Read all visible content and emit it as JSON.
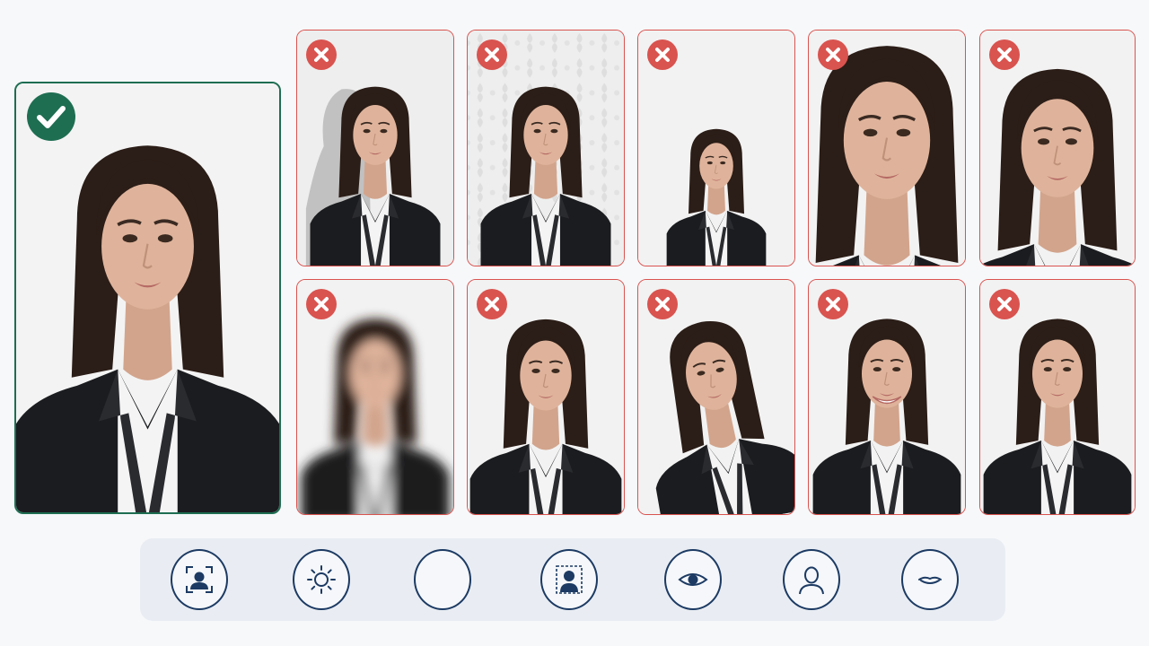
{
  "colors": {
    "accept": "#1e6e52",
    "reject": "#d9534f",
    "icon_stroke": "#1c3a63",
    "toolbar_bg": "#e9edf3"
  },
  "examples": [
    {
      "status": "accepted",
      "icon": "check-icon",
      "issue": "compliant"
    },
    {
      "status": "rejected",
      "icon": "x-icon",
      "issue": "shadow-on-background"
    },
    {
      "status": "rejected",
      "icon": "x-icon",
      "issue": "patterned-background"
    },
    {
      "status": "rejected",
      "icon": "x-icon",
      "issue": "too-far"
    },
    {
      "status": "rejected",
      "icon": "x-icon",
      "issue": "too-close"
    },
    {
      "status": "rejected",
      "icon": "x-icon",
      "issue": "cropped"
    },
    {
      "status": "rejected",
      "icon": "x-icon",
      "issue": "blurry"
    },
    {
      "status": "rejected",
      "icon": "x-icon",
      "issue": "looking-away"
    },
    {
      "status": "rejected",
      "icon": "x-icon",
      "issue": "head-tilted"
    },
    {
      "status": "rejected",
      "icon": "x-icon",
      "issue": "smiling"
    },
    {
      "status": "rejected",
      "icon": "x-icon",
      "issue": "heavy-makeup"
    }
  ],
  "toolbar": {
    "icons": [
      "face-frame-icon",
      "brightness-icon",
      "circle-icon",
      "head-position-icon",
      "eye-icon",
      "head-shoulders-icon",
      "neutral-mouth-icon"
    ]
  }
}
